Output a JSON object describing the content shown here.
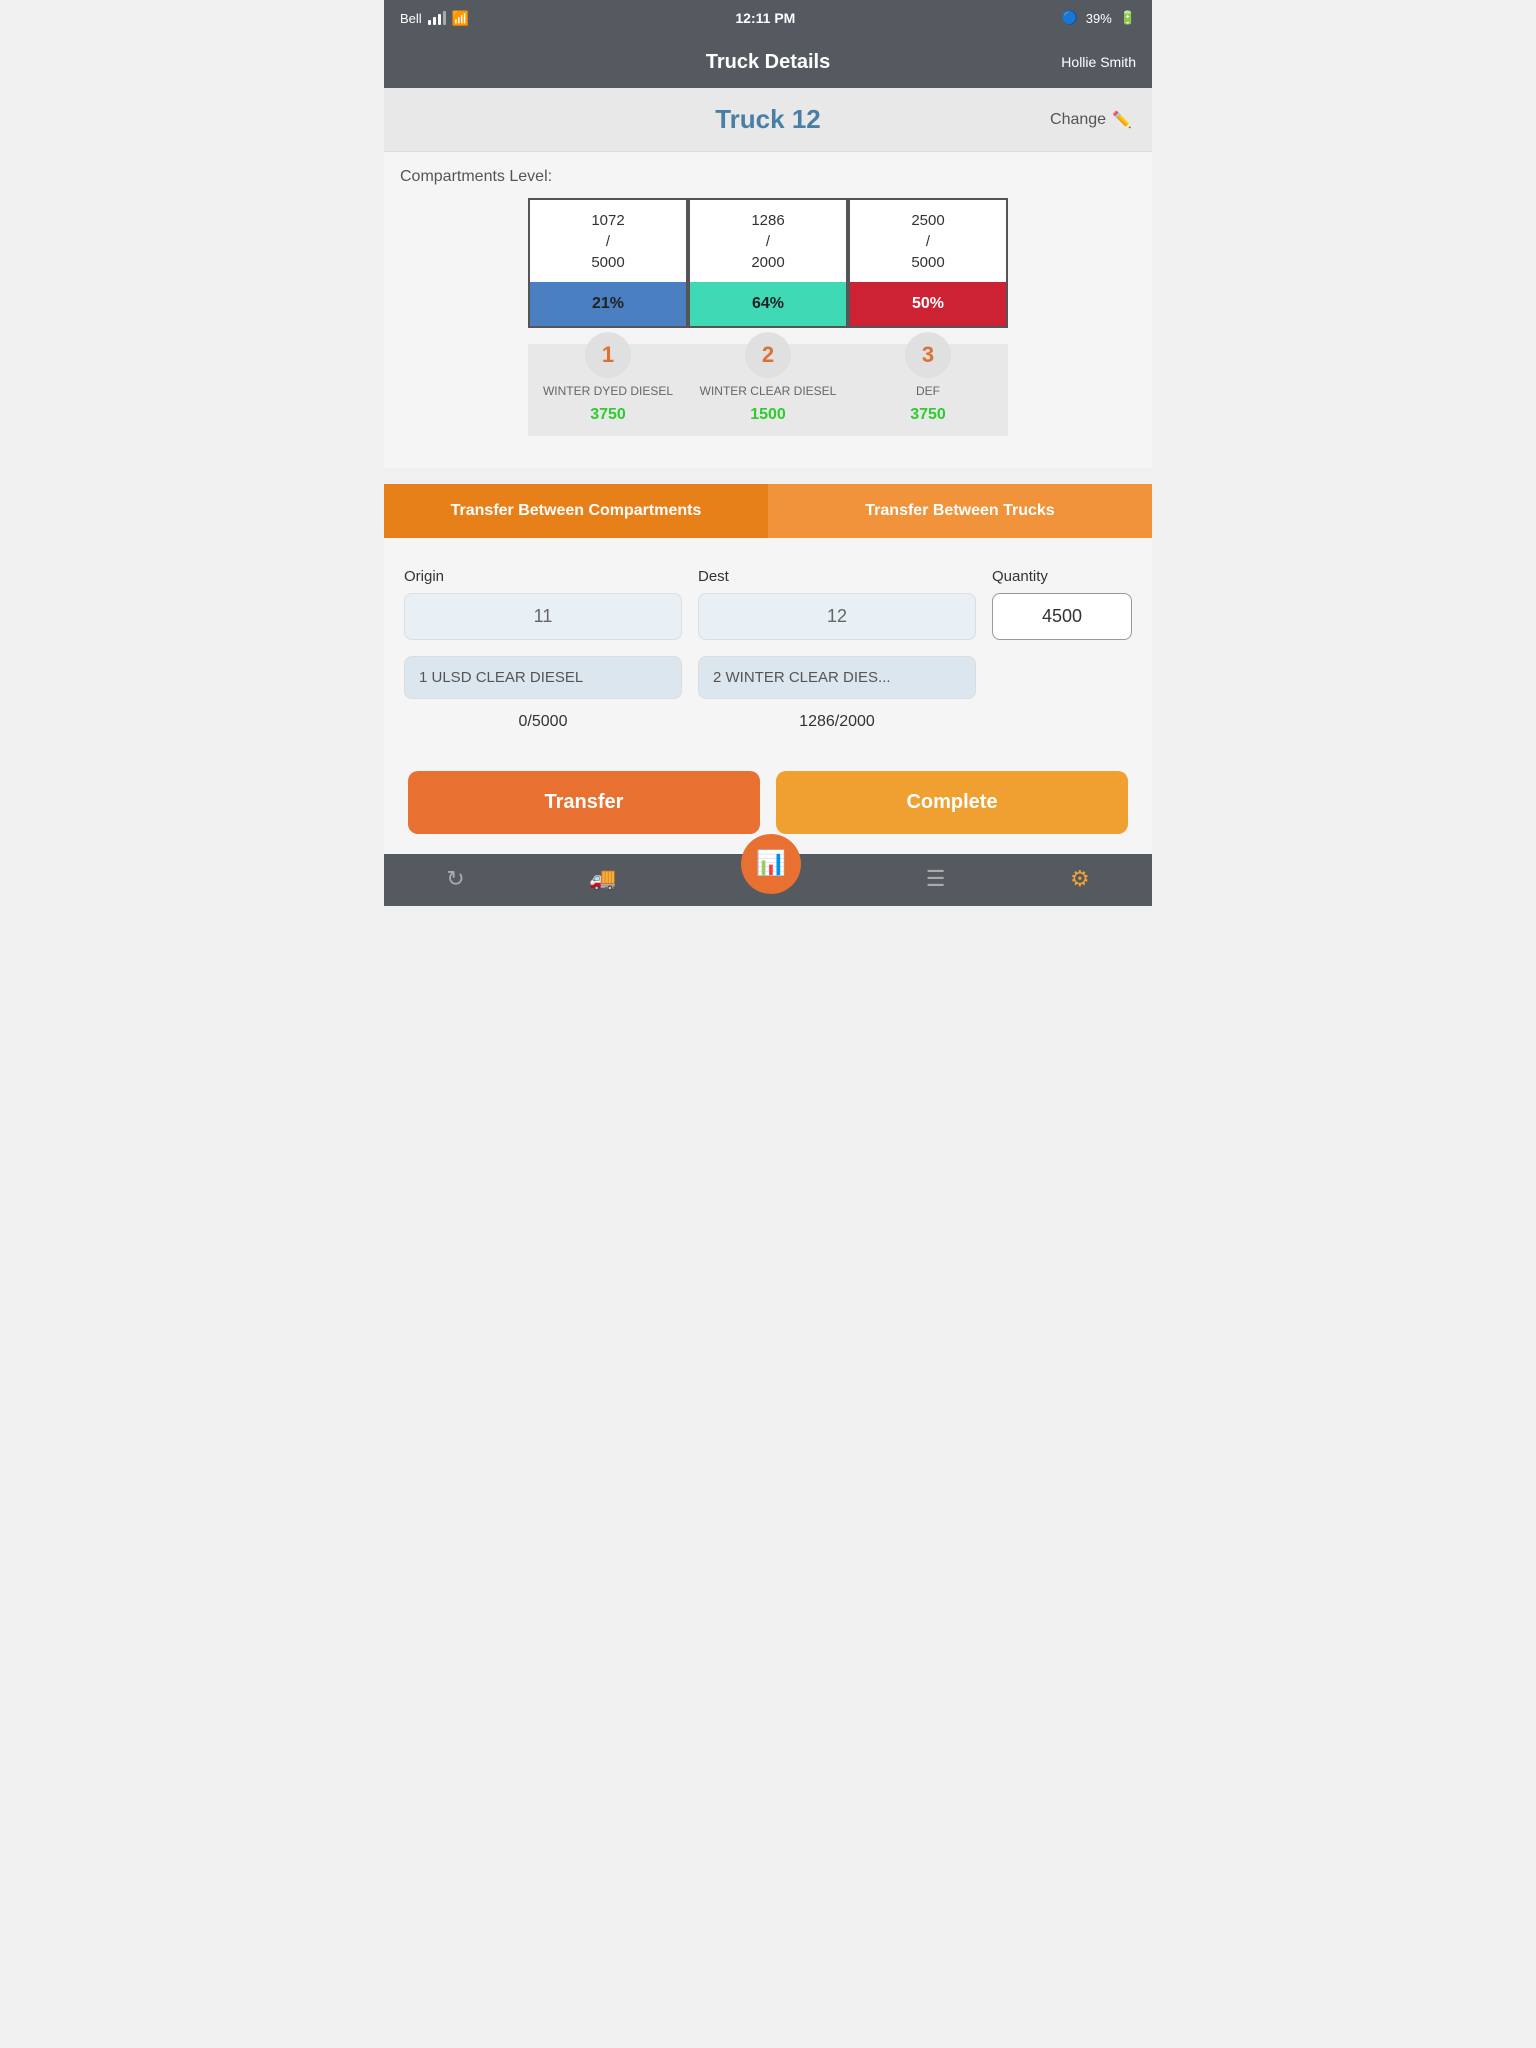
{
  "statusBar": {
    "carrier": "Bell",
    "time": "12:11 PM",
    "bluetooth": "BT",
    "battery": "39%"
  },
  "navBar": {
    "title": "Truck Details",
    "user": "Hollie Smith"
  },
  "truckHeader": {
    "truckName": "Truck 12",
    "changeLabel": "Change"
  },
  "compartmentsSection": {
    "label": "Compartments Level:",
    "compartments": [
      {
        "current": 1072,
        "max": 5000,
        "percent": "21%",
        "fillClass": "fill-blue",
        "number": "1",
        "name": "WINTER DYED DIESEL",
        "available": "3750"
      },
      {
        "current": 1286,
        "max": 2000,
        "percent": "64%",
        "fillClass": "fill-teal",
        "number": "2",
        "name": "WINTER CLEAR DIESEL",
        "available": "1500"
      },
      {
        "current": 2500,
        "max": 5000,
        "percent": "50%",
        "fillClass": "fill-red",
        "number": "3",
        "name": "DEF",
        "available": "3750"
      }
    ]
  },
  "tabs": {
    "tab1": "Transfer Between Compartments",
    "tab2": "Transfer Between Trucks",
    "activeTab": 1
  },
  "transferForm": {
    "originLabel": "Origin",
    "destLabel": "Dest",
    "quantityLabel": "Quantity",
    "originValue": "11",
    "destValue": "12",
    "quantityValue": "4500",
    "originProduct": "1 ULSD CLEAR DIESEL",
    "destProduct": "2 WINTER CLEAR DIES...",
    "originCapacity": "0/5000",
    "destCapacity": "1286/2000"
  },
  "buttons": {
    "transfer": "Transfer",
    "complete": "Complete"
  },
  "bottomNav": {
    "items": [
      "refresh",
      "truck",
      "chart",
      "list",
      "gear"
    ]
  }
}
